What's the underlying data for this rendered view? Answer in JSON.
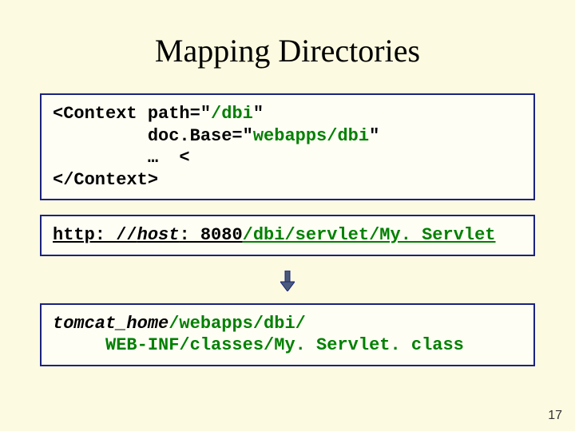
{
  "title": "Mapping Directories",
  "box1": {
    "l1a": "<Context path=\"",
    "l1b": "/dbi",
    "l1c": "\"",
    "l2a": "         doc.Base=\"",
    "l2b": "webapps/dbi",
    "l2c": "\"",
    "l3": "         …  <",
    "l4": "</Context>"
  },
  "box2": {
    "text_a": "http: //",
    "text_b": "host",
    "text_c": ": 8080",
    "text_d": "/dbi/servlet/My. Servlet"
  },
  "box3": {
    "l1a": "tomcat_home",
    "l1b": "/webapps/dbi/",
    "l2": "     WEB-INF/classes/My. Servlet. class"
  },
  "page_number": "17"
}
